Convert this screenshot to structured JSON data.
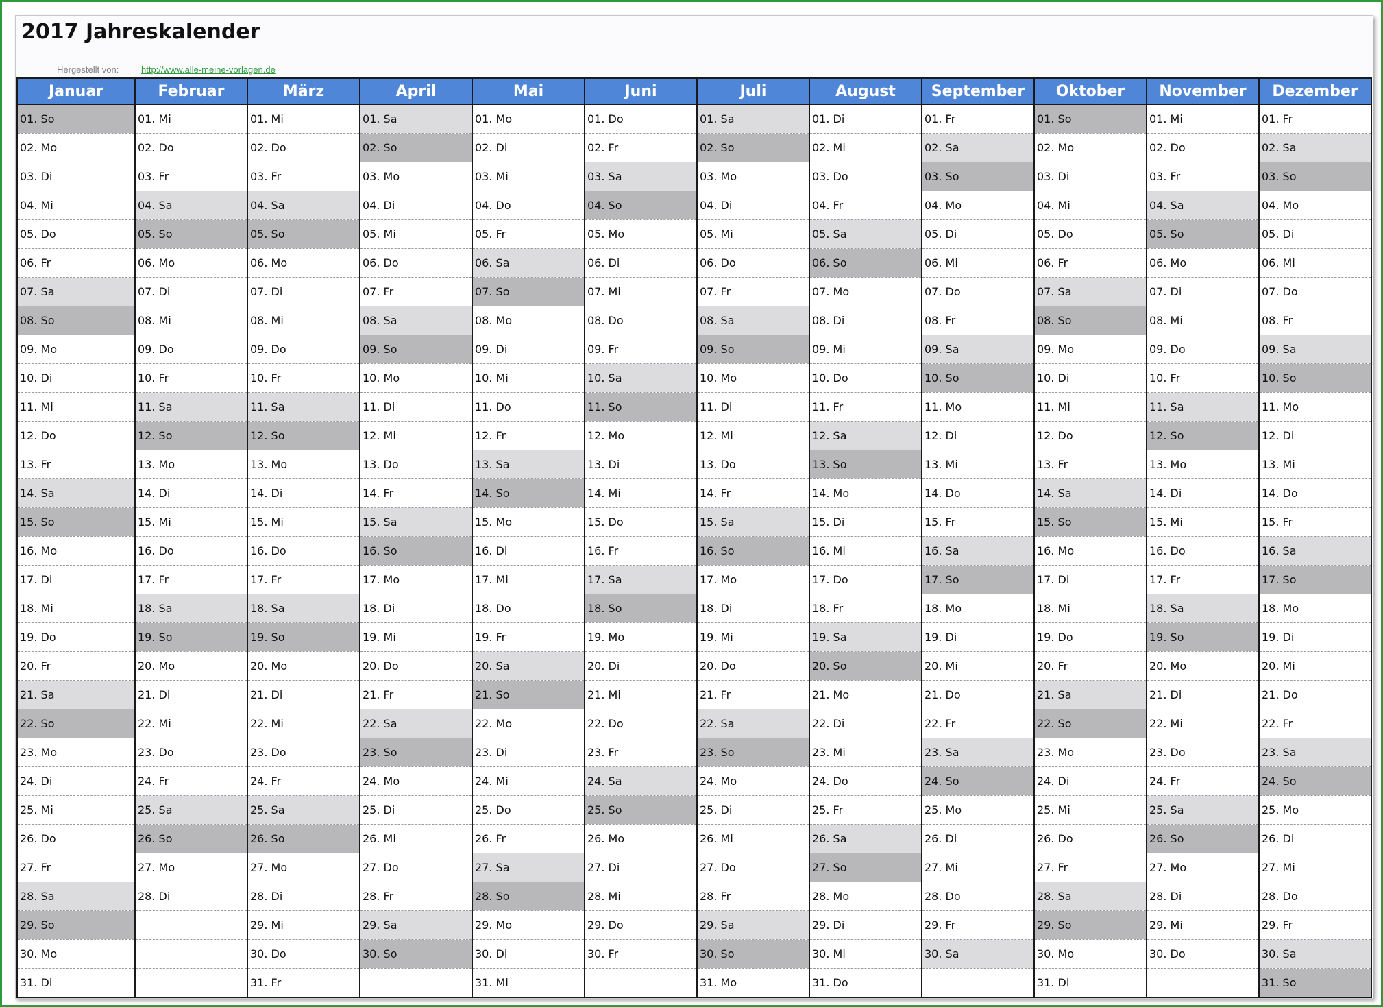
{
  "title": "2017 Jahreskalender",
  "credit": {
    "label": "Hergestellt von:",
    "link": "http://www.alle-meine-vorlagen.de"
  },
  "colors": {
    "header_bg": "#4f86d8",
    "saturday_bg": "#dcdcdf",
    "sunday_bg": "#b8b8bb",
    "frame": "#2e9a3c"
  },
  "months": [
    {
      "name": "Januar",
      "days": [
        "01. So",
        "02. Mo",
        "03. Di",
        "04. Mi",
        "05. Do",
        "06. Fr",
        "07. Sa",
        "08. So",
        "09. Mo",
        "10. Di",
        "11. Mi",
        "12. Do",
        "13. Fr",
        "14. Sa",
        "15. So",
        "16. Mo",
        "17. Di",
        "18. Mi",
        "19. Do",
        "20. Fr",
        "21. Sa",
        "22. So",
        "23. Mo",
        "24. Di",
        "25. Mi",
        "26. Do",
        "27. Fr",
        "28. Sa",
        "29. So",
        "30. Mo",
        "31. Di"
      ]
    },
    {
      "name": "Februar",
      "days": [
        "01. Mi",
        "02. Do",
        "03. Fr",
        "04. Sa",
        "05. So",
        "06. Mo",
        "07. Di",
        "08. Mi",
        "09. Do",
        "10. Fr",
        "11. Sa",
        "12. So",
        "13. Mo",
        "14. Di",
        "15. Mi",
        "16. Do",
        "17. Fr",
        "18. Sa",
        "19. So",
        "20. Mo",
        "21. Di",
        "22. Mi",
        "23. Do",
        "24. Fr",
        "25. Sa",
        "26. So",
        "27. Mo",
        "28. Di"
      ]
    },
    {
      "name": "März",
      "days": [
        "01. Mi",
        "02. Do",
        "03. Fr",
        "04. Sa",
        "05. So",
        "06. Mo",
        "07. Di",
        "08. Mi",
        "09. Do",
        "10. Fr",
        "11. Sa",
        "12. So",
        "13. Mo",
        "14. Di",
        "15. Mi",
        "16. Do",
        "17. Fr",
        "18. Sa",
        "19. So",
        "20. Mo",
        "21. Di",
        "22. Mi",
        "23. Do",
        "24. Fr",
        "25. Sa",
        "26. So",
        "27. Mo",
        "28. Di",
        "29. Mi",
        "30. Do",
        "31. Fr"
      ]
    },
    {
      "name": "April",
      "days": [
        "01. Sa",
        "02. So",
        "03. Mo",
        "04. Di",
        "05. Mi",
        "06. Do",
        "07. Fr",
        "08. Sa",
        "09. So",
        "10. Mo",
        "11. Di",
        "12. Mi",
        "13. Do",
        "14. Fr",
        "15. Sa",
        "16. So",
        "17. Mo",
        "18. Di",
        "19. Mi",
        "20. Do",
        "21. Fr",
        "22. Sa",
        "23. So",
        "24. Mo",
        "25. Di",
        "26. Mi",
        "27. Do",
        "28. Fr",
        "29. Sa",
        "30. So"
      ]
    },
    {
      "name": "Mai",
      "days": [
        "01. Mo",
        "02. Di",
        "03. Mi",
        "04. Do",
        "05. Fr",
        "06. Sa",
        "07. So",
        "08. Mo",
        "09. Di",
        "10. Mi",
        "11. Do",
        "12. Fr",
        "13. Sa",
        "14. So",
        "15. Mo",
        "16. Di",
        "17. Mi",
        "18. Do",
        "19. Fr",
        "20. Sa",
        "21. So",
        "22. Mo",
        "23. Di",
        "24. Mi",
        "25. Do",
        "26. Fr",
        "27. Sa",
        "28. So",
        "29. Mo",
        "30. Di",
        "31. Mi"
      ]
    },
    {
      "name": "Juni",
      "days": [
        "01. Do",
        "02. Fr",
        "03. Sa",
        "04. So",
        "05. Mo",
        "06. Di",
        "07. Mi",
        "08. Do",
        "09. Fr",
        "10. Sa",
        "11. So",
        "12. Mo",
        "13. Di",
        "14. Mi",
        "15. Do",
        "16. Fr",
        "17. Sa",
        "18. So",
        "19. Mo",
        "20. Di",
        "21. Mi",
        "22. Do",
        "23. Fr",
        "24. Sa",
        "25. So",
        "26. Mo",
        "27. Di",
        "28. Mi",
        "29. Do",
        "30. Fr"
      ]
    },
    {
      "name": "Juli",
      "days": [
        "01. Sa",
        "02. So",
        "03. Mo",
        "04. Di",
        "05. Mi",
        "06. Do",
        "07. Fr",
        "08. Sa",
        "09. So",
        "10. Mo",
        "11. Di",
        "12. Mi",
        "13. Do",
        "14. Fr",
        "15. Sa",
        "16. So",
        "17. Mo",
        "18. Di",
        "19. Mi",
        "20. Do",
        "21. Fr",
        "22. Sa",
        "23. So",
        "24. Mo",
        "25. Di",
        "26. Mi",
        "27. Do",
        "28. Fr",
        "29. Sa",
        "30. So",
        "31. Mo"
      ]
    },
    {
      "name": "August",
      "days": [
        "01. Di",
        "02. Mi",
        "03. Do",
        "04. Fr",
        "05. Sa",
        "06. So",
        "07. Mo",
        "08. Di",
        "09. Mi",
        "10. Do",
        "11. Fr",
        "12. Sa",
        "13. So",
        "14. Mo",
        "15. Di",
        "16. Mi",
        "17. Do",
        "18. Fr",
        "19. Sa",
        "20. So",
        "21. Mo",
        "22. Di",
        "23. Mi",
        "24. Do",
        "25. Fr",
        "26. Sa",
        "27. So",
        "28. Mo",
        "29. Di",
        "30. Mi",
        "31. Do"
      ]
    },
    {
      "name": "September",
      "days": [
        "01. Fr",
        "02. Sa",
        "03. So",
        "04. Mo",
        "05. Di",
        "06. Mi",
        "07. Do",
        "08. Fr",
        "09. Sa",
        "10. So",
        "11. Mo",
        "12. Di",
        "13. Mi",
        "14. Do",
        "15. Fr",
        "16. Sa",
        "17. So",
        "18. Mo",
        "19. Di",
        "20. Mi",
        "21. Do",
        "22. Fr",
        "23. Sa",
        "24. So",
        "25. Mo",
        "26. Di",
        "27. Mi",
        "28. Do",
        "29. Fr",
        "30. Sa"
      ]
    },
    {
      "name": "Oktober",
      "days": [
        "01. So",
        "02. Mo",
        "03. Di",
        "04. Mi",
        "05. Do",
        "06. Fr",
        "07. Sa",
        "08. So",
        "09. Mo",
        "10. Di",
        "11. Mi",
        "12. Do",
        "13. Fr",
        "14. Sa",
        "15. So",
        "16. Mo",
        "17. Di",
        "18. Mi",
        "19. Do",
        "20. Fr",
        "21. Sa",
        "22. So",
        "23. Mo",
        "24. Di",
        "25. Mi",
        "26. Do",
        "27. Fr",
        "28. Sa",
        "29. So",
        "30. Mo",
        "31. Di"
      ]
    },
    {
      "name": "November",
      "days": [
        "01. Mi",
        "02. Do",
        "03. Fr",
        "04. Sa",
        "05. So",
        "06. Mo",
        "07. Di",
        "08. Mi",
        "09. Do",
        "10. Fr",
        "11. Sa",
        "12. So",
        "13. Mo",
        "14. Di",
        "15. Mi",
        "16. Do",
        "17. Fr",
        "18. Sa",
        "19. So",
        "20. Mo",
        "21. Di",
        "22. Mi",
        "23. Do",
        "24. Fr",
        "25. Sa",
        "26. So",
        "27. Mo",
        "28. Di",
        "29. Mi",
        "30. Do"
      ]
    },
    {
      "name": "Dezember",
      "days": [
        "01. Fr",
        "02. Sa",
        "03. So",
        "04. Mo",
        "05. Di",
        "06. Mi",
        "07. Do",
        "08. Fr",
        "09. Sa",
        "10. So",
        "11. Mo",
        "12. Di",
        "13. Mi",
        "14. Do",
        "15. Fr",
        "16. Sa",
        "17. So",
        "18. Mo",
        "19. Di",
        "20. Mi",
        "21. Do",
        "22. Fr",
        "23. Sa",
        "24. So",
        "25. Mo",
        "26. Di",
        "27. Mi",
        "28. Do",
        "29. Fr",
        "30. Sa",
        "31. So"
      ]
    }
  ]
}
